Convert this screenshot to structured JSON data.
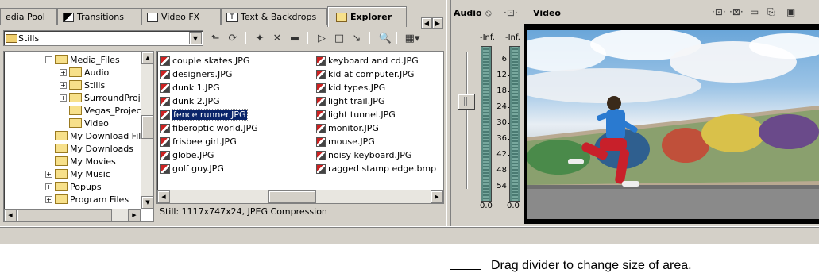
{
  "tabs": [
    {
      "label": "edia Pool",
      "icon": "media-pool-icon"
    },
    {
      "label": "Transitions",
      "icon": "transitions-icon"
    },
    {
      "label": "Video FX",
      "icon": "video-fx-icon"
    },
    {
      "label": "Text & Backdrops",
      "icon": "text-icon"
    },
    {
      "label": "Explorer",
      "icon": "explorer-icon",
      "active": true
    }
  ],
  "explorer": {
    "path_value": "Stills",
    "tree": [
      {
        "label": "Media_Files",
        "expander": "−",
        "level": 1
      },
      {
        "label": "Audio",
        "expander": "+",
        "level": 2
      },
      {
        "label": "Stills",
        "expander": "+",
        "level": 2
      },
      {
        "label": "SurroundProj",
        "expander": "+",
        "level": 2
      },
      {
        "label": "Vegas_Projec",
        "expander": "",
        "level": 2
      },
      {
        "label": "Video",
        "expander": "",
        "level": 2
      },
      {
        "label": "My Download File",
        "expander": "",
        "level": 1
      },
      {
        "label": "My Downloads",
        "expander": "",
        "level": 1
      },
      {
        "label": "My Movies",
        "expander": "",
        "level": 1
      },
      {
        "label": "My Music",
        "expander": "+",
        "level": 1
      },
      {
        "label": "Popups",
        "expander": "+",
        "level": 1
      },
      {
        "label": "Program Files",
        "expander": "+",
        "level": 1
      }
    ],
    "files_col1": [
      "couple skates.JPG",
      "designers.JPG",
      "dunk 1.JPG",
      "dunk 2.JPG",
      "fence runner.JPG",
      "fiberoptic world.JPG",
      "frisbee girl.JPG",
      "globe.JPG",
      "golf guy.JPG"
    ],
    "files_col2": [
      "keyboard and cd.JPG",
      "kid at computer.JPG",
      "kid types.JPG",
      "light trail.JPG",
      "light tunnel.JPG",
      "monitor.JPG",
      "mouse.JPG",
      "noisy keyboard.JPG",
      "ragged stamp edge.bmp"
    ],
    "selected_file": "fence runner.JPG",
    "status": "Still: 1117x747x24, JPEG Compression"
  },
  "audio": {
    "title": "Audio",
    "meter_left_label": "-Inf.",
    "meter_right_label": "-Inf.",
    "scale": [
      "6",
      "12",
      "18",
      "24",
      "30",
      "36",
      "42",
      "48",
      "54"
    ],
    "readout_left": "0.0",
    "readout_right": "0.0"
  },
  "video": {
    "title": "Video"
  },
  "callout": "Drag divider to change size of area."
}
